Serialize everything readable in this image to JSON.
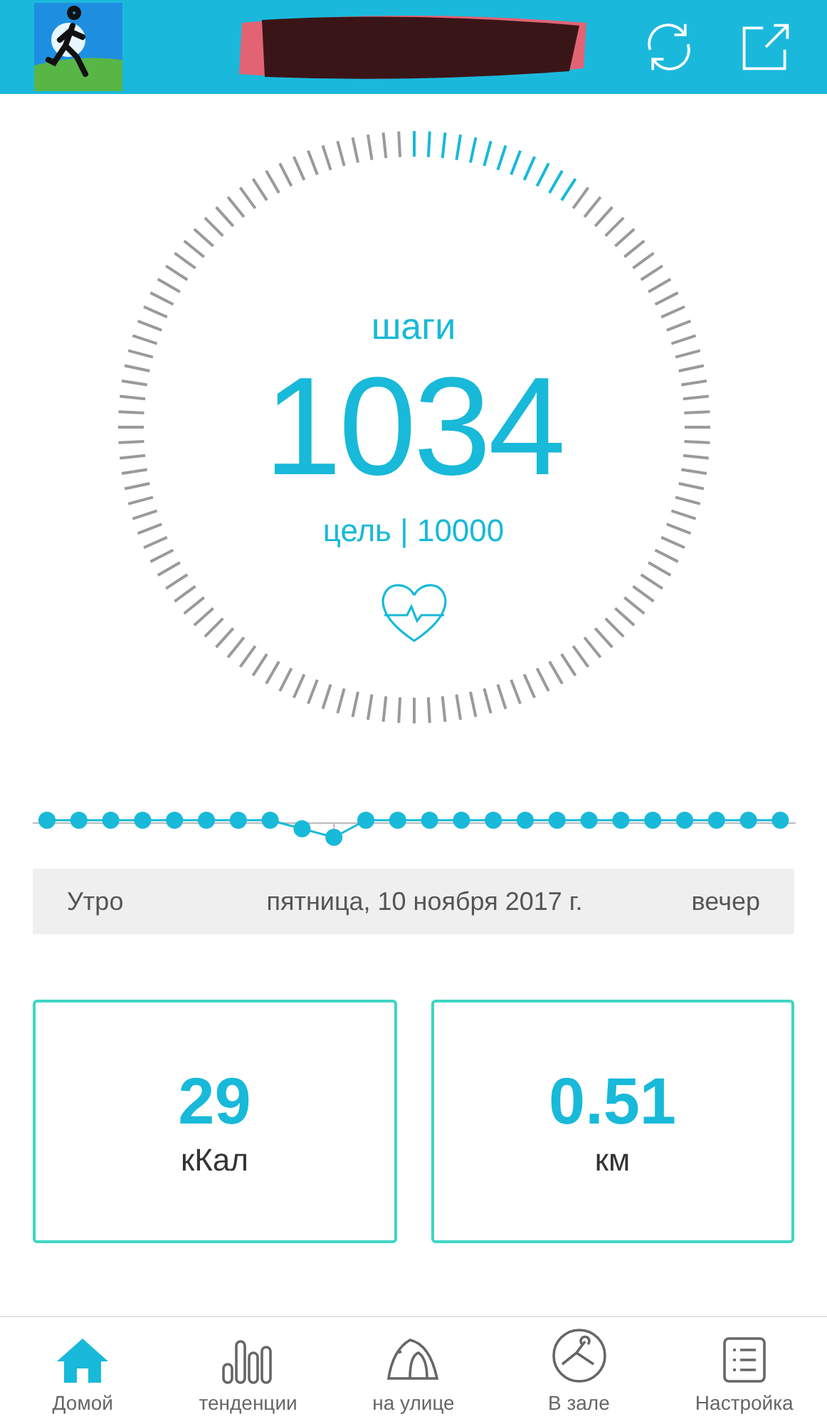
{
  "steps": {
    "label": "шаги",
    "value": "1034",
    "goal": "цель | 10000"
  },
  "timeline": {
    "start": "Утро",
    "date": "пятница, 10 ноября 2017 г.",
    "end": "вечер"
  },
  "stats": [
    {
      "value": "29",
      "unit": "кКал"
    },
    {
      "value": "0.51",
      "unit": "км"
    }
  ],
  "nav": [
    {
      "kind": "home",
      "label": "Домой",
      "selected": true
    },
    {
      "kind": "trends",
      "label": "тенденции",
      "selected": false
    },
    {
      "kind": "outdoor",
      "label": "на улице",
      "selected": false
    },
    {
      "kind": "gym",
      "label": "В зале",
      "selected": false
    },
    {
      "kind": "settings",
      "label": "Настройка",
      "selected": false
    }
  ]
}
